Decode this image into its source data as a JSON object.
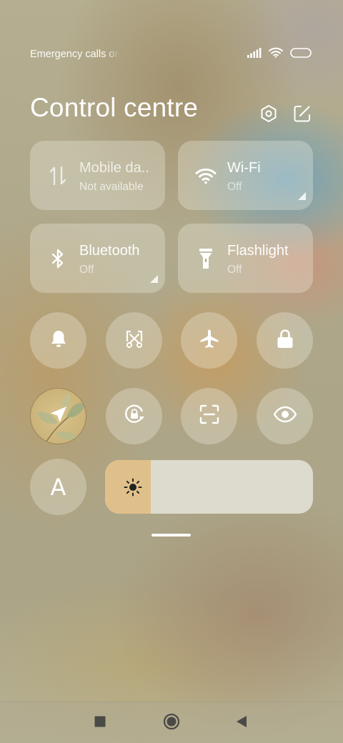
{
  "status_bar": {
    "carrier_text": "Emergency calls only",
    "icons": [
      "signal-icon",
      "wifi-icon",
      "battery-icon"
    ]
  },
  "header": {
    "title": "Control centre",
    "settings_icon": "settings-hexagon-icon",
    "edit_icon": "edit-icon"
  },
  "tiles": [
    {
      "label": "Mobile da..",
      "status": "Not available",
      "icon": "mobile-data-icon"
    },
    {
      "label": "Wi-Fi",
      "status": "Off",
      "icon": "wifi-icon"
    },
    {
      "label": "Bluetooth",
      "status": "Off",
      "icon": "bluetooth-icon"
    },
    {
      "label": "Flashlight",
      "status": "Off",
      "icon": "flashlight-icon"
    }
  ],
  "toggles_row1": [
    "bell-icon",
    "screenshot-icon",
    "airplane-icon",
    "lock-icon"
  ],
  "toggles_row2": [
    "location-icon",
    "rotation-lock-icon",
    "scan-icon",
    "eye-icon"
  ],
  "auto_brightness": {
    "letter": "A",
    "icon": "auto-brightness-icon"
  },
  "brightness": {
    "level": 0.22,
    "icon": "sun-icon"
  },
  "nav_bar": {
    "icons": [
      "recents-square-icon",
      "home-circle-icon",
      "back-triangle-icon"
    ]
  },
  "colors": {
    "brightness_fill": "#e0c08a",
    "tile_bg": "rgba(240,238,226,0.32)"
  }
}
